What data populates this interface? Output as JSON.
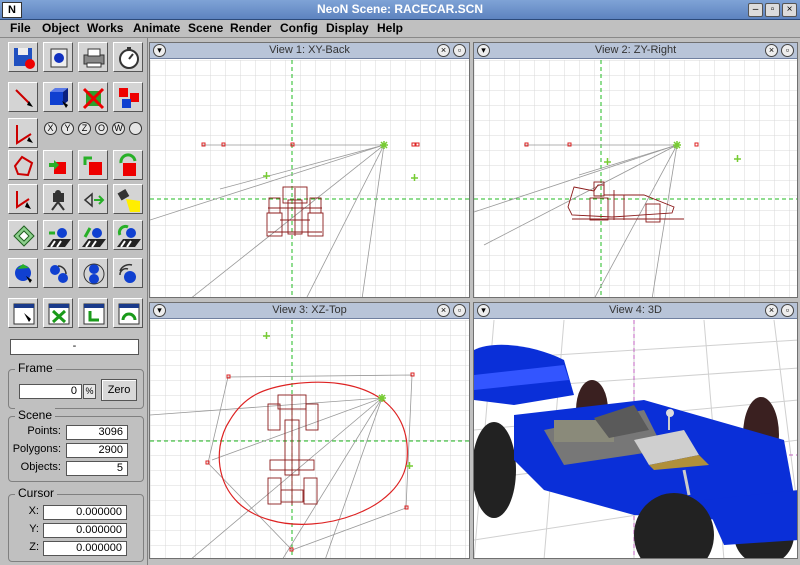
{
  "window": {
    "title": "NeoN Scene: RACECAR.SCN",
    "logo": "N",
    "buttons": {
      "minimize": "–",
      "restore": "▫",
      "close": "×"
    }
  },
  "menu": [
    "File",
    "Object",
    "Works",
    "Animate",
    "Scene",
    "Render",
    "Config",
    "Display",
    "Help"
  ],
  "toolbar": {
    "axes": [
      "X",
      "Y",
      "Z",
      "O",
      "W"
    ],
    "status_field": "-",
    "frame": {
      "title": "Frame",
      "value": "0",
      "zero_label": "Zero",
      "percent_glyph": "%"
    },
    "scene": {
      "title": "Scene",
      "points_label": "Points:",
      "points": "3096",
      "polygons_label": "Polygons:",
      "polygons": "2900",
      "objects_label": "Objects:",
      "objects": "5"
    },
    "cursor": {
      "title": "Cursor",
      "x_label": "X:",
      "x": "0.000000",
      "y_label": "Y:",
      "y": "0.000000",
      "z_label": "Z:",
      "z": "0.000000"
    }
  },
  "views": [
    {
      "title": "View 1: XY-Back"
    },
    {
      "title": "View 2: ZY-Right"
    },
    {
      "title": "View 3: XZ-Top"
    },
    {
      "title": "View 4: 3D"
    }
  ],
  "colors": {
    "accent": "#5d83bf",
    "grid": "#d8d8d8",
    "axis": "#22bb22",
    "wire": "#8b1a1a",
    "spline": "#dd2222",
    "car_blue": "#0a2fd8"
  }
}
